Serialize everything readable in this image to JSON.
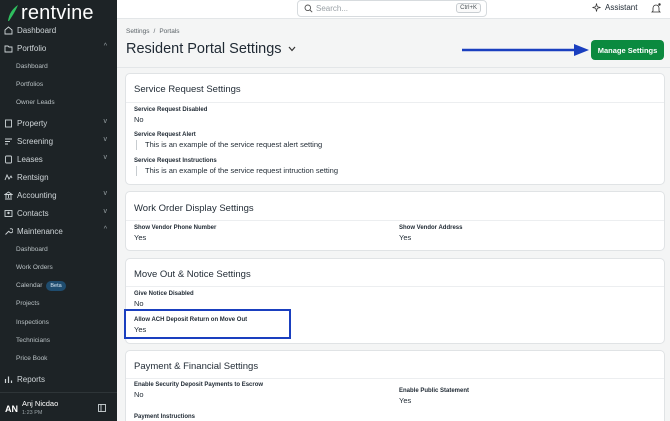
{
  "app": {
    "brand": "rentvine",
    "search_placeholder": "Search...",
    "search_shortcut": "Ctrl+K",
    "assistant_label": "Assistant"
  },
  "sidebar": {
    "dashboard": "Dashboard",
    "portfolio": "Portfolio",
    "portfolio_sub": [
      "Dashboard",
      "Portfolios",
      "Owner Leads"
    ],
    "property": "Property",
    "screening": "Screening",
    "leases": "Leases",
    "rentsign": "Rentsign",
    "accounting": "Accounting",
    "contacts": "Contacts",
    "maintenance": "Maintenance",
    "maintenance_sub": [
      "Dashboard",
      "Work Orders",
      "Calendar",
      "Projects",
      "Inspections",
      "Technicians",
      "Price Book"
    ],
    "calendar_badge": "Beta",
    "reports": "Reports"
  },
  "user": {
    "initials": "AN",
    "name": "Anj Nicdao",
    "time": "1:23 PM"
  },
  "header": {
    "breadcrumb": [
      "Settings",
      "Portals"
    ],
    "breadcrumb_sep": "/",
    "title": "Resident Portal Settings",
    "manage_button": "Manage Settings"
  },
  "sections": {
    "service_request": {
      "title": "Service Request Settings",
      "disabled_label": "Service Request Disabled",
      "disabled_value": "No",
      "alert_label": "Service Request Alert",
      "alert_value": "This is an example of the service request alert setting",
      "instructions_label": "Service Request Instructions",
      "instructions_value": "This is an example of the service request intruction setting"
    },
    "work_order": {
      "title": "Work Order Display Settings",
      "phone_label": "Show Vendor Phone Number",
      "phone_value": "Yes",
      "address_label": "Show Vendor Address",
      "address_value": "Yes"
    },
    "move_out": {
      "title": "Move Out & Notice Settings",
      "notice_label": "Give Notice Disabled",
      "notice_value": "No",
      "ach_label": "Allow ACH Deposit Return on Move Out",
      "ach_value": "Yes"
    },
    "payment": {
      "title": "Payment & Financial Settings",
      "escrow_label": "Enable Security Deposit Payments to Escrow",
      "escrow_value": "No",
      "statement_label": "Enable Public Statement",
      "statement_value": "Yes",
      "instructions_label": "Payment Instructions"
    }
  },
  "colors": {
    "sidebar_bg": "#1d2326",
    "accent_green": "#0b8a3f",
    "annotation_blue": "#1a3fbf"
  }
}
